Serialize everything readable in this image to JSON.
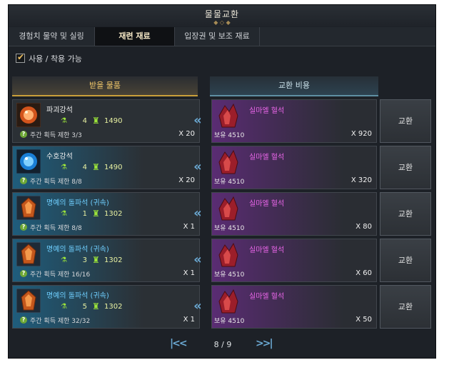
{
  "window": {
    "title": "물물교환"
  },
  "tabs": [
    {
      "label": "경험치 물약 및 실링"
    },
    {
      "label": "재련 재료"
    },
    {
      "label": "입장권 및 보조 재료"
    }
  ],
  "filter": {
    "label": "사용 / 착용 가능",
    "checked": true
  },
  "headers": {
    "receive": "받을 물품",
    "cost": "교환 비용"
  },
  "rows": [
    {
      "icon": "destruction-stone-icon",
      "name": "파괴강석",
      "level": "4",
      "gear_score": "1490",
      "limit": "주간 획득 제한 3/3",
      "qty": "X 20",
      "cost_name": "실마엘 혈석",
      "own": "보유 4510",
      "cost_qty": "X 920",
      "button": "교환"
    },
    {
      "icon": "guardian-stone-icon",
      "name": "수호강석",
      "level": "4",
      "gear_score": "1490",
      "limit": "주간 획득 제한 8/8",
      "qty": "X 20",
      "cost_name": "실마엘 혈석",
      "own": "보유 4510",
      "cost_qty": "X 320",
      "button": "교환"
    },
    {
      "icon": "honor-leapstone-icon",
      "name": "명예의 돌파석 (귀속)",
      "level": "1",
      "gear_score": "1302",
      "limit": "주간 획득 제한 8/8",
      "qty": "X 1",
      "cost_name": "실마엘 혈석",
      "own": "보유 4510",
      "cost_qty": "X 80",
      "button": "교환"
    },
    {
      "icon": "honor-leapstone-icon",
      "name": "명예의 돌파석 (귀속)",
      "level": "3",
      "gear_score": "1302",
      "limit": "주간 획득 제한 16/16",
      "qty": "X 1",
      "cost_name": "실마엘 혈석",
      "own": "보유 4510",
      "cost_qty": "X 60",
      "button": "교환"
    },
    {
      "icon": "honor-leapstone-icon",
      "name": "명예의 돌파석 (귀속)",
      "level": "5",
      "gear_score": "1302",
      "limit": "주간 획득 제한 32/32",
      "qty": "X 1",
      "cost_name": "실마엘 혈석",
      "own": "보유 4510",
      "cost_qty": "X 50",
      "button": "교환"
    }
  ],
  "pager": {
    "current": "8 / 9"
  },
  "colors": {
    "accent_gold": "#c99f3a",
    "cost_purple": "#ea66e9",
    "level_green": "#9be33a"
  }
}
